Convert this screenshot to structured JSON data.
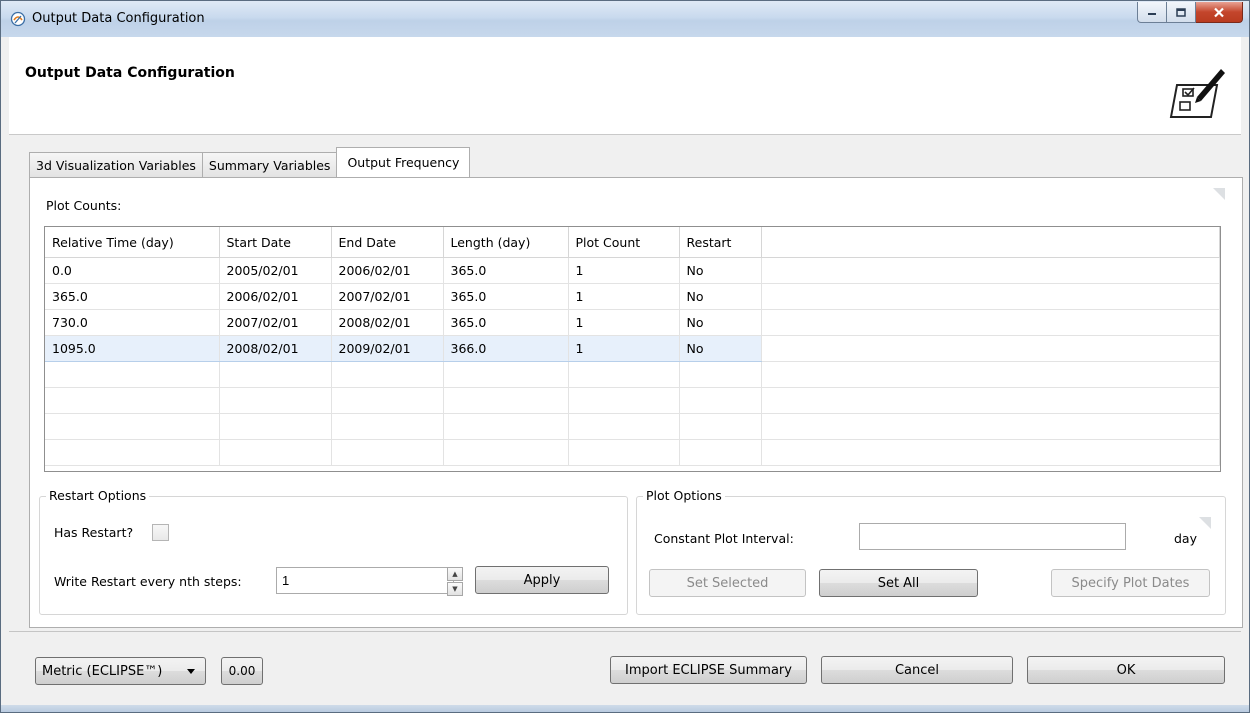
{
  "window": {
    "title": "Output Data Configuration",
    "header_title": "Output Data Configuration"
  },
  "tabs": [
    {
      "label": "3d Visualization Variables",
      "active": false
    },
    {
      "label": "Summary Variables",
      "active": false
    },
    {
      "label": "Output Frequency",
      "active": true
    }
  ],
  "plot_counts": {
    "label": "Plot Counts:",
    "columns": [
      "Relative Time (day)",
      "Start Date",
      "End Date",
      "Length (day)",
      "Plot Count",
      "Restart"
    ],
    "rows": [
      [
        "0.0",
        "2005/02/01",
        "2006/02/01",
        "365.0",
        "1",
        "No"
      ],
      [
        "365.0",
        "2006/02/01",
        "2007/02/01",
        "365.0",
        "1",
        "No"
      ],
      [
        "730.0",
        "2007/02/01",
        "2008/02/01",
        "365.0",
        "1",
        "No"
      ],
      [
        "1095.0",
        "2008/02/01",
        "2009/02/01",
        "366.0",
        "1",
        "No"
      ]
    ],
    "selected_row": 3
  },
  "restart_options": {
    "title": "Restart Options",
    "has_restart_label": "Has Restart?",
    "has_restart_checked": false,
    "write_restart_label": "Write Restart every nth steps:",
    "write_restart_value": "1",
    "apply_label": "Apply"
  },
  "plot_options": {
    "title": "Plot Options",
    "interval_label": "Constant Plot Interval:",
    "interval_value": "",
    "unit": "day",
    "set_selected_label": "Set Selected",
    "set_all_label": "Set All",
    "specify_dates_label": "Specify Plot Dates"
  },
  "footer": {
    "unit_system": "Metric (ECLIPSE™)",
    "version_badge": "0.00",
    "import_label": "Import ECLIPSE Summary",
    "cancel_label": "Cancel",
    "ok_label": "OK"
  },
  "colors": {
    "selected_row_bg": "#e7f0fb",
    "titlebar": "#c9daee",
    "close_button": "#c4462c"
  }
}
